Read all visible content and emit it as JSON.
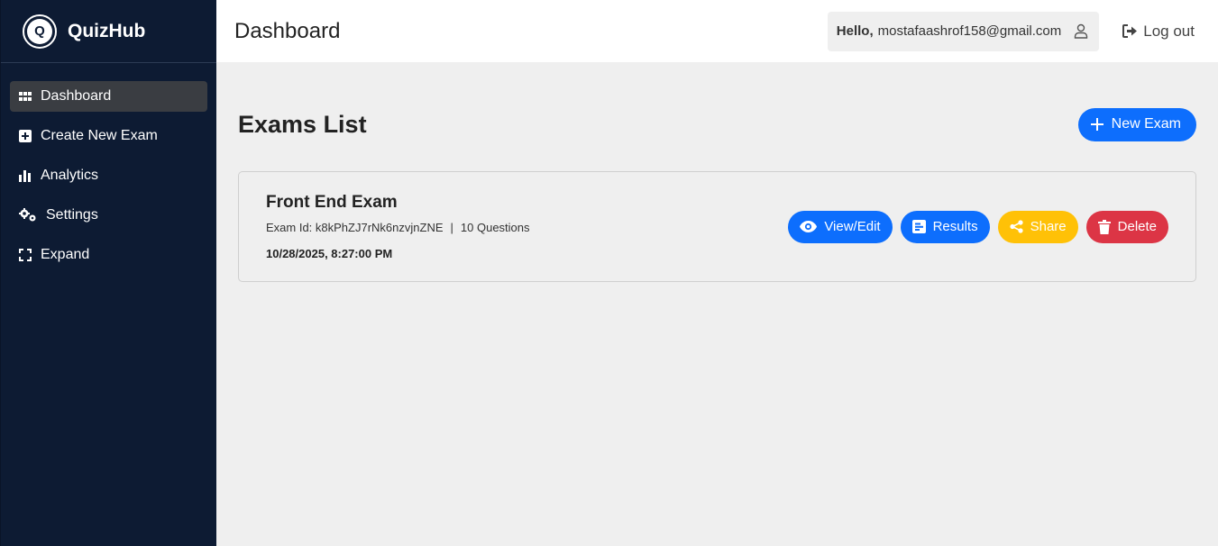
{
  "brand": {
    "logo_letter": "Q",
    "name": "QuizHub"
  },
  "sidebar": {
    "items": [
      {
        "label": "Dashboard",
        "icon": "grid-icon",
        "active": true
      },
      {
        "label": "Create New Exam",
        "icon": "plus-square-icon"
      },
      {
        "label": "Analytics",
        "icon": "bar-chart-icon"
      },
      {
        "label": "Settings",
        "icon": "gears-icon"
      },
      {
        "label": "Expand",
        "icon": "expand-icon"
      }
    ]
  },
  "header": {
    "title": "Dashboard",
    "hello_label": "Hello,",
    "user_email": "mostafaashrof158@gmail.com",
    "logout_label": "Log out"
  },
  "main": {
    "section_title": "Exams List",
    "new_exam_label": "New Exam",
    "exams": [
      {
        "title": "Front End Exam",
        "id_label": "Exam Id: k8kPhZJ7rNk6nzvjnZNE",
        "separator": "|",
        "questions_label": "10 Questions",
        "date": "10/28/2025, 8:27:00 PM",
        "actions": {
          "view_edit": "View/Edit",
          "results": "Results",
          "share": "Share",
          "delete": "Delete"
        }
      }
    ]
  },
  "colors": {
    "sidebar_bg": "#0d1b33",
    "primary": "#0d6efd",
    "warning": "#ffc107",
    "danger": "#dc3545"
  }
}
